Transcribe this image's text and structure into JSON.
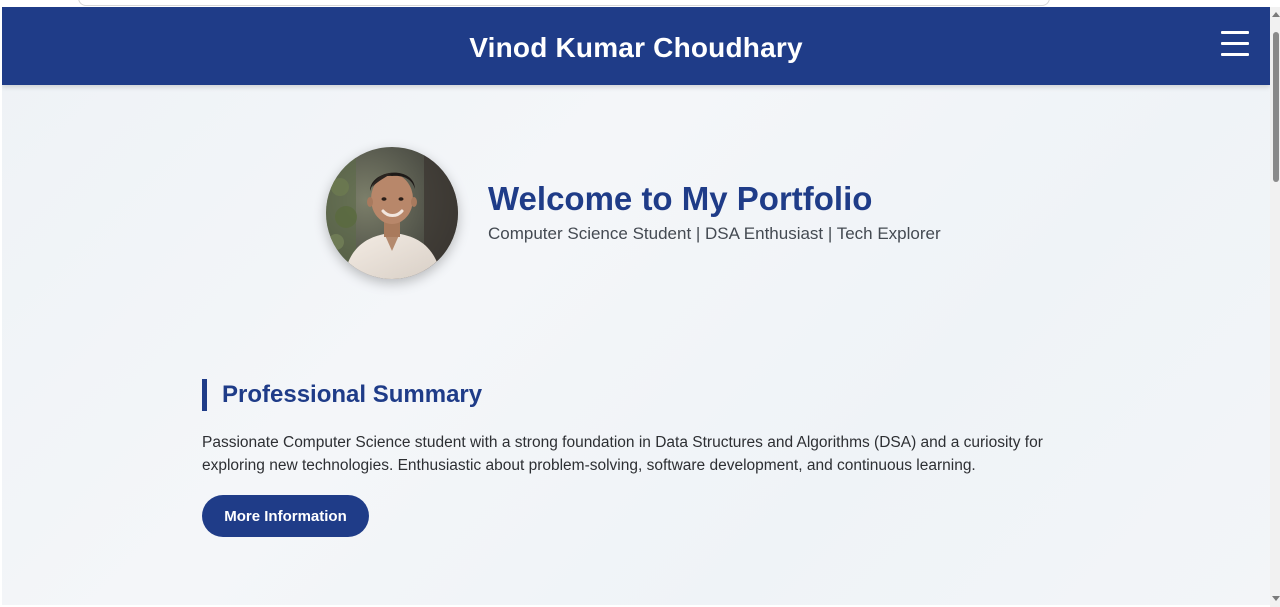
{
  "header": {
    "title": "Vinod Kumar Choudhary",
    "menu_icon": "hamburger-menu-icon",
    "background_color": "#1f3c88"
  },
  "hero": {
    "avatar_icon": "profile-photo",
    "heading": "Welcome to My Portfolio",
    "tagline": "Computer Science Student | DSA Enthusiast | Tech Explorer"
  },
  "summary": {
    "heading": "Professional Summary",
    "text": "Passionate Computer Science student with a strong foundation in Data Structures and Algorithms (DSA) and a curiosity for exploring new technologies. Enthusiastic about problem-solving, software development, and continuous learning.",
    "button_label": "More Information"
  },
  "colors": {
    "accent": "#1f3c88",
    "text": "#2d2f33",
    "background": "#f0f3f7"
  }
}
